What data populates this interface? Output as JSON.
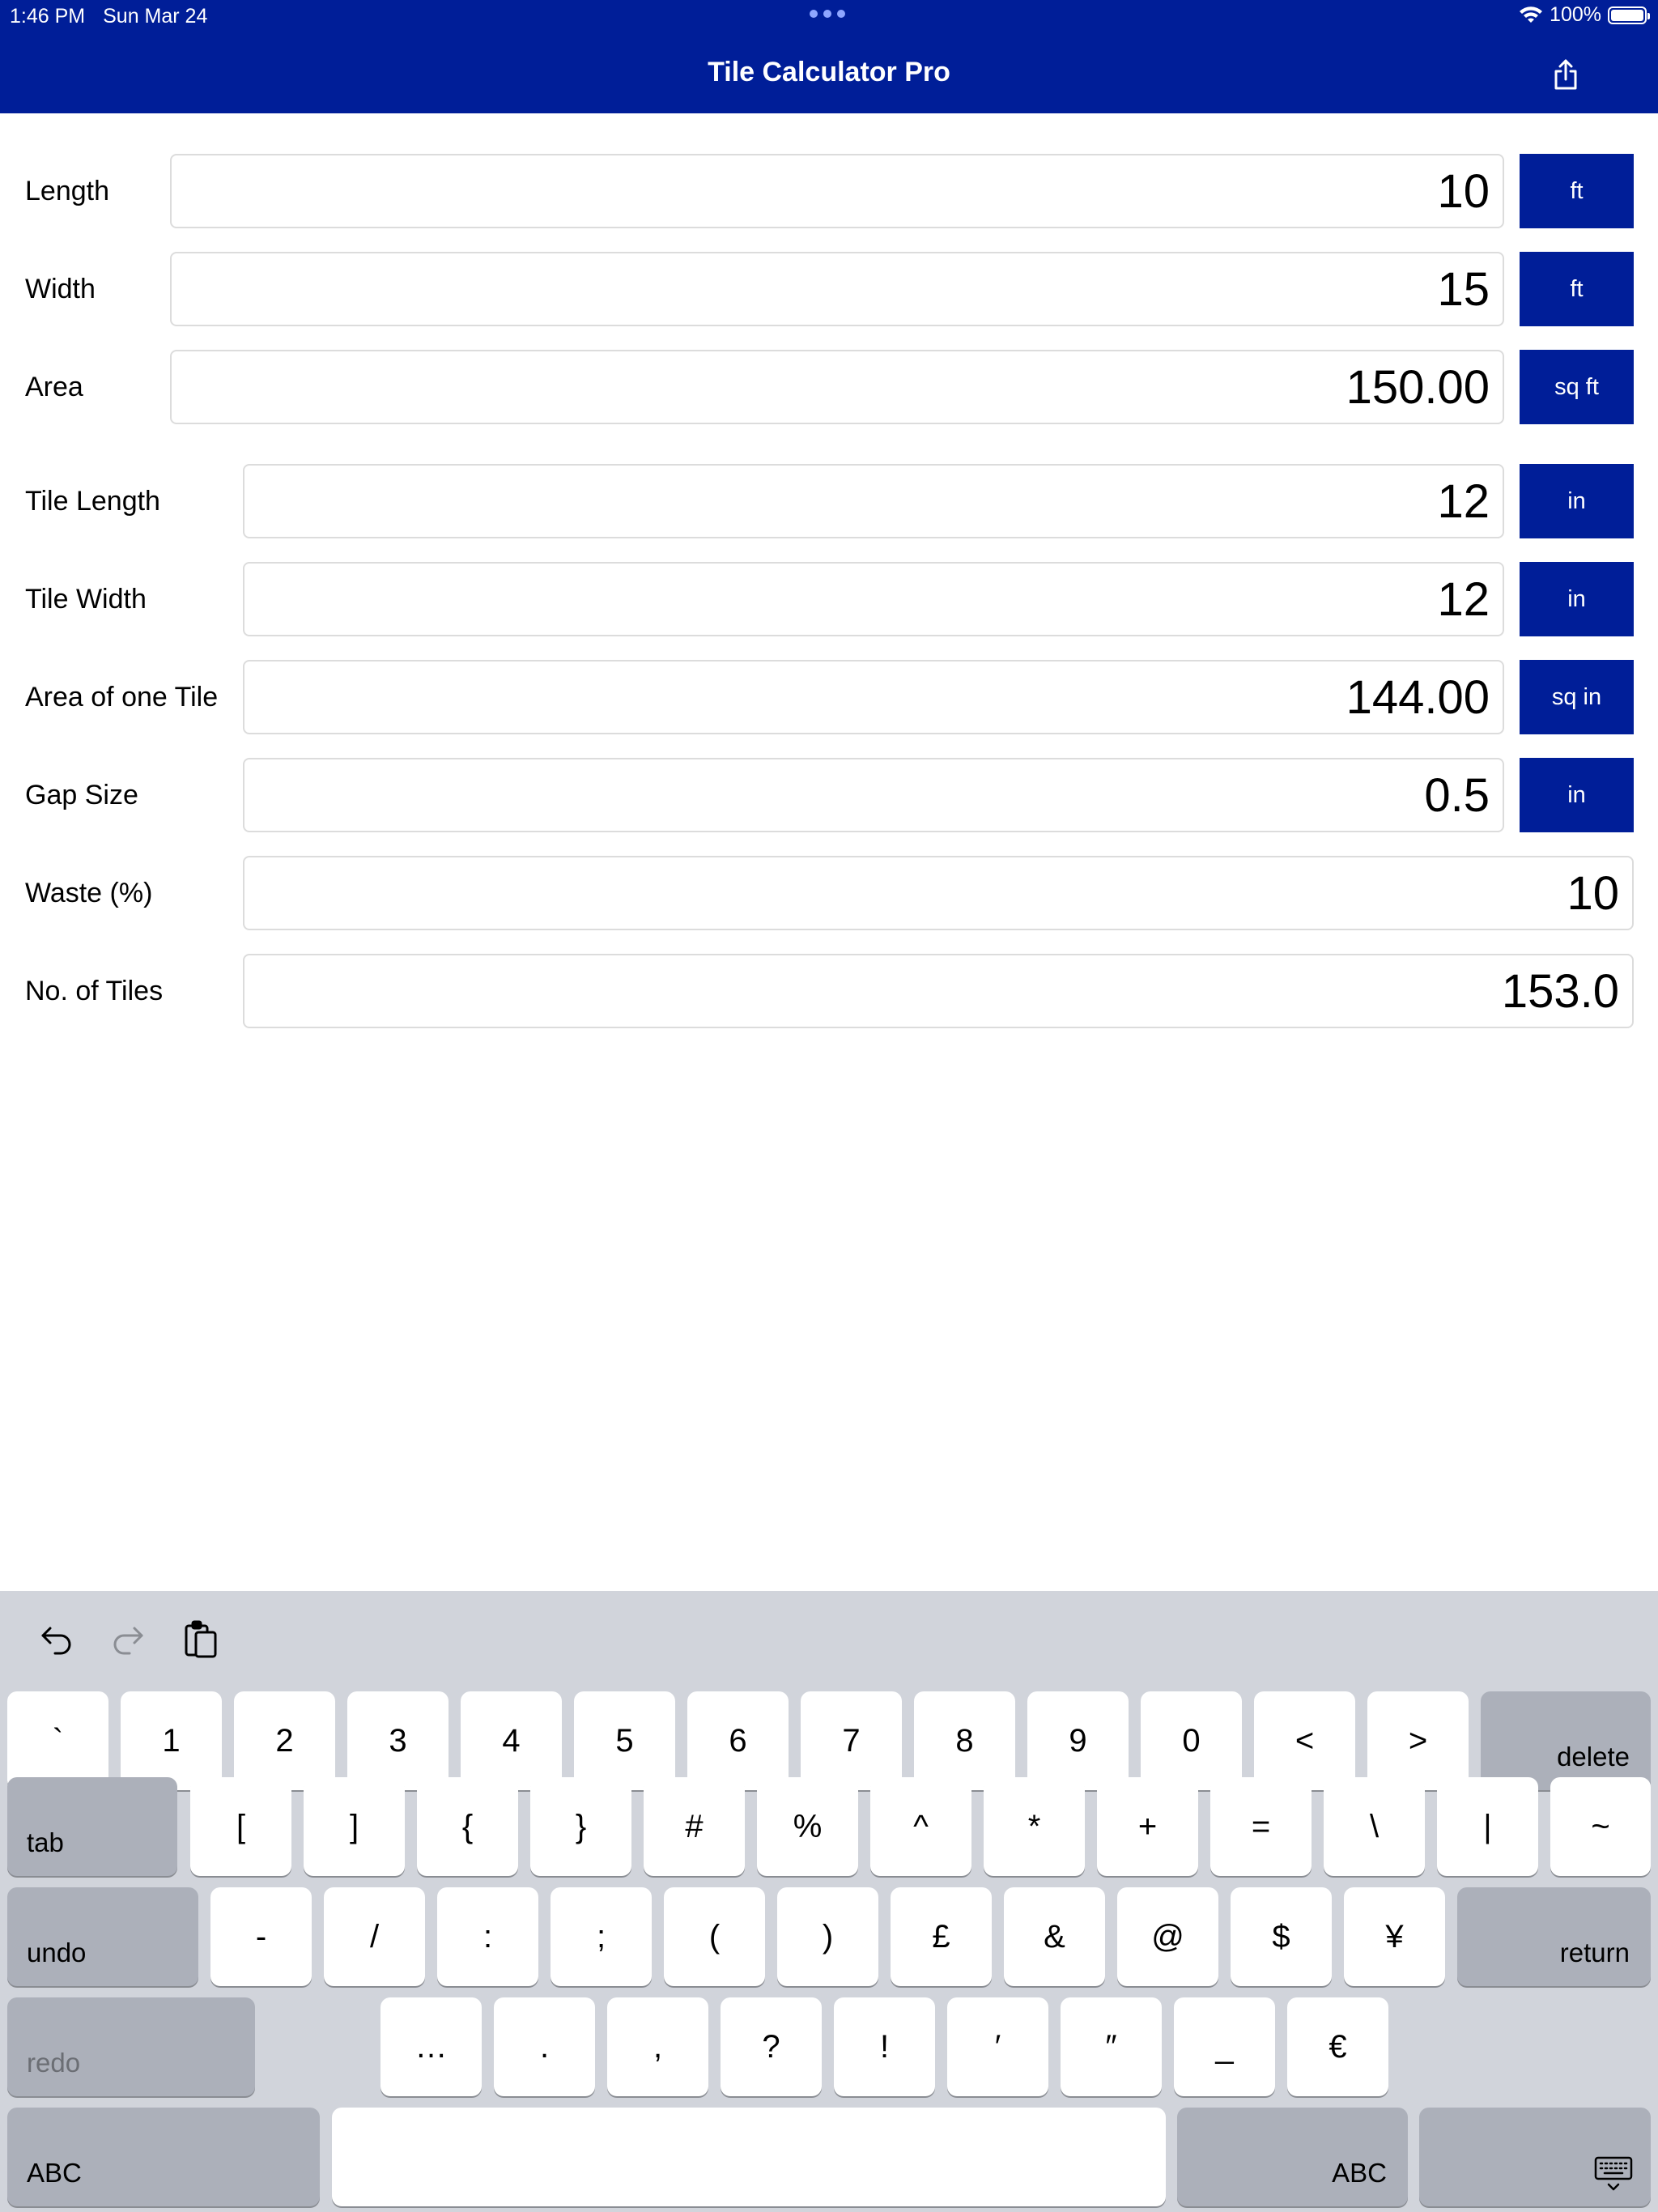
{
  "status_bar": {
    "time": "1:46 PM",
    "date": "Sun Mar 24",
    "battery": "100%"
  },
  "header": {
    "title": "Tile Calculator Pro",
    "share_icon": "share-icon"
  },
  "form": {
    "length": {
      "label": "Length",
      "value": "10",
      "unit": "ft"
    },
    "width": {
      "label": "Width",
      "value": "15",
      "unit": "ft"
    },
    "area": {
      "label": "Area",
      "value": "150.00",
      "unit": "sq ft"
    },
    "tile_length": {
      "label": "Tile Length",
      "value": "12",
      "unit": "in"
    },
    "tile_width": {
      "label": "Tile Width",
      "value": "12",
      "unit": "in"
    },
    "tile_area": {
      "label": "Area of one Tile",
      "value": "144.00",
      "unit": "sq in"
    },
    "gap_size": {
      "label": "Gap Size",
      "value": "0.5",
      "unit": "in"
    },
    "waste": {
      "label": "Waste (%)",
      "value": "10"
    },
    "tiles": {
      "label": "No. of Tiles",
      "value": "153.0"
    }
  },
  "keyboard": {
    "toolbar_icons": [
      "undo-icon",
      "redo-icon",
      "paste-icon"
    ],
    "row1": [
      "`",
      "1",
      "2",
      "3",
      "4",
      "5",
      "6",
      "7",
      "8",
      "9",
      "0",
      "<",
      ">"
    ],
    "delete": "delete",
    "tab": "tab",
    "row2": [
      "[",
      "]",
      "{",
      "}",
      "#",
      "%",
      "^",
      "*",
      "+",
      "=",
      "\\",
      "|",
      "~"
    ],
    "undo": "undo",
    "row3": [
      "-",
      "/",
      ":",
      ";",
      "(",
      ")",
      "£",
      "&",
      "@",
      "$",
      "¥"
    ],
    "return": "return",
    "redo": "redo",
    "row4": [
      "…",
      ".",
      ",",
      "?",
      "!",
      "′",
      "″",
      "_",
      "€"
    ],
    "abc_left": "ABC",
    "abc_right": "ABC",
    "dismiss_icon": "keyboard-dismiss-icon"
  },
  "colors": {
    "accent": "#001E98",
    "keyboard_bg": "#D1D4DB",
    "key_dark": "#ACB0BA"
  }
}
